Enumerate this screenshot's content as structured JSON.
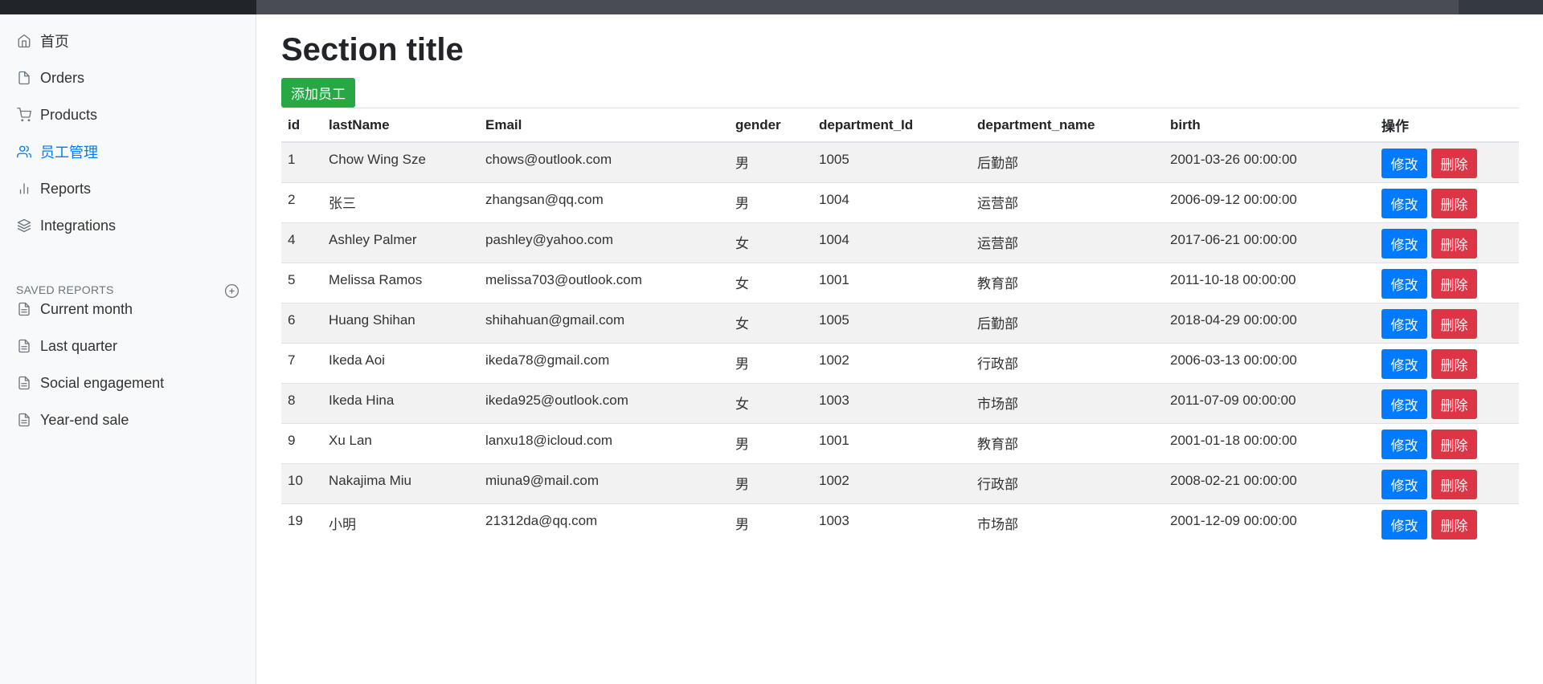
{
  "sidebar": {
    "nav": [
      {
        "label": "首页",
        "icon": "home-icon"
      },
      {
        "label": "Orders",
        "icon": "file-icon"
      },
      {
        "label": "Products",
        "icon": "cart-icon"
      },
      {
        "label": "员工管理",
        "icon": "users-icon"
      },
      {
        "label": "Reports",
        "icon": "bar-chart-icon"
      },
      {
        "label": "Integrations",
        "icon": "layers-icon"
      }
    ],
    "saved_heading": "SAVED REPORTS",
    "saved": [
      {
        "label": "Current month",
        "icon": "file-text-icon"
      },
      {
        "label": "Last quarter",
        "icon": "file-text-icon"
      },
      {
        "label": "Social engagement",
        "icon": "file-text-icon"
      },
      {
        "label": "Year-end sale",
        "icon": "file-text-icon"
      }
    ]
  },
  "main": {
    "title": "Section title",
    "add_label": "添加员工",
    "columns": [
      "id",
      "lastName",
      "Email",
      "gender",
      "department_Id",
      "department_name",
      "birth",
      "操作"
    ],
    "edit_label": "修改",
    "delete_label": "删除",
    "rows": [
      {
        "id": "1",
        "lastName": "Chow Wing Sze",
        "email": "chows@outlook.com",
        "gender": "男",
        "department_id": "1005",
        "department_name": "后勤部",
        "birth": "2001-03-26 00:00:00"
      },
      {
        "id": "2",
        "lastName": "张三",
        "email": "zhangsan@qq.com",
        "gender": "男",
        "department_id": "1004",
        "department_name": "运营部",
        "birth": "2006-09-12 00:00:00"
      },
      {
        "id": "4",
        "lastName": "Ashley Palmer",
        "email": "pashley@yahoo.com",
        "gender": "女",
        "department_id": "1004",
        "department_name": "运营部",
        "birth": "2017-06-21 00:00:00"
      },
      {
        "id": "5",
        "lastName": "Melissa Ramos",
        "email": "melissa703@outlook.com",
        "gender": "女",
        "department_id": "1001",
        "department_name": "教育部",
        "birth": "2011-10-18 00:00:00"
      },
      {
        "id": "6",
        "lastName": "Huang Shihan",
        "email": "shihahuan@gmail.com",
        "gender": "女",
        "department_id": "1005",
        "department_name": "后勤部",
        "birth": "2018-04-29 00:00:00"
      },
      {
        "id": "7",
        "lastName": "Ikeda Aoi",
        "email": "ikeda78@gmail.com",
        "gender": "男",
        "department_id": "1002",
        "department_name": "行政部",
        "birth": "2006-03-13 00:00:00"
      },
      {
        "id": "8",
        "lastName": "Ikeda Hina",
        "email": "ikeda925@outlook.com",
        "gender": "女",
        "department_id": "1003",
        "department_name": "市场部",
        "birth": "2011-07-09 00:00:00"
      },
      {
        "id": "9",
        "lastName": "Xu Lan",
        "email": "lanxu18@icloud.com",
        "gender": "男",
        "department_id": "1001",
        "department_name": "教育部",
        "birth": "2001-01-18 00:00:00"
      },
      {
        "id": "10",
        "lastName": "Nakajima Miu",
        "email": "miuna9@mail.com",
        "gender": "男",
        "department_id": "1002",
        "department_name": "行政部",
        "birth": "2008-02-21 00:00:00"
      },
      {
        "id": "19",
        "lastName": "小明",
        "email": "21312da@qq.com",
        "gender": "男",
        "department_id": "1003",
        "department_name": "市场部",
        "birth": "2001-12-09 00:00:00"
      }
    ]
  },
  "colors": {
    "primary": "#007bff",
    "success": "#28a745",
    "danger": "#dc3545",
    "sidebar_bg": "#f8f9fa",
    "navbar_dark": "#212529"
  }
}
